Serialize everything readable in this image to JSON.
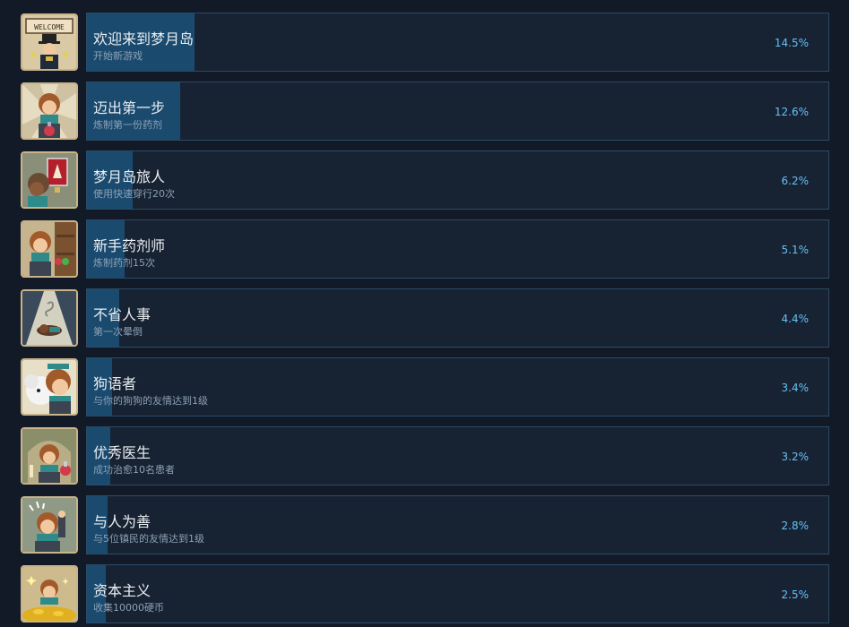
{
  "colors": {
    "background": "#111a26",
    "panel": "#172233",
    "bar": "#1a4a6e",
    "percent": "#66c0f4"
  },
  "achievements": [
    {
      "icon": "welcome-sign-icon",
      "title": "欢迎来到梦月岛",
      "desc": "开始新游戏",
      "percent_label": "14.5%",
      "percent": 14.5
    },
    {
      "icon": "first-potion-icon",
      "title": "迈出第一步",
      "desc": "炼制第一份药剂",
      "percent_label": "12.6%",
      "percent": 12.6
    },
    {
      "icon": "traveler-icon",
      "title": "梦月岛旅人",
      "desc": "使用快速穿行20次",
      "percent_label": "6.2%",
      "percent": 6.2
    },
    {
      "icon": "apprentice-chemist-icon",
      "title": "新手药剂师",
      "desc": "炼制药剂15次",
      "percent_label": "5.1%",
      "percent": 5.1
    },
    {
      "icon": "fainted-icon",
      "title": "不省人事",
      "desc": "第一次晕倒",
      "percent_label": "4.4%",
      "percent": 4.4
    },
    {
      "icon": "dog-friend-icon",
      "title": "狗语者",
      "desc": "与你的狗狗的友情达到1级",
      "percent_label": "3.4%",
      "percent": 3.4
    },
    {
      "icon": "doctor-icon",
      "title": "优秀医生",
      "desc": "成功治愈10名患者",
      "percent_label": "3.2%",
      "percent": 3.2
    },
    {
      "icon": "kindness-icon",
      "title": "与人为善",
      "desc": "与5位镇民的友情达到1级",
      "percent_label": "2.8%",
      "percent": 2.8
    },
    {
      "icon": "gold-coins-icon",
      "title": "资本主义",
      "desc": "收集10000硬币",
      "percent_label": "2.5%",
      "percent": 2.5
    }
  ]
}
